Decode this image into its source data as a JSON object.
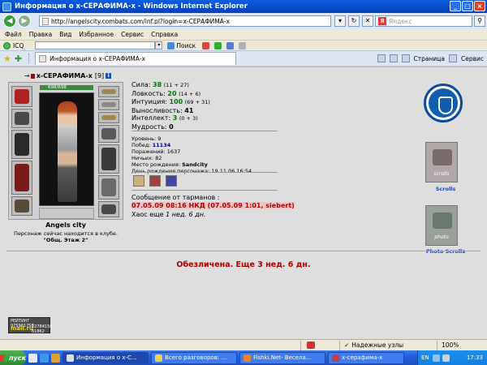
{
  "window": {
    "title": "Информация о х-СЕРАФИМА-х - Windows Internet Explorer",
    "minimize": "_",
    "maximize": "□",
    "close": "×"
  },
  "address": {
    "url": "http://angelscity.combats.com/inf.pl?login=х-СЕРАФИМА-х",
    "search_placeholder": "Яндекс"
  },
  "menu": [
    "Файл",
    "Правка",
    "Вид",
    "Избранное",
    "Сервис",
    "Справка"
  ],
  "icq_bar": {
    "label": "ICQ",
    "search_label": "Поиск"
  },
  "tabbar": {
    "tab_title": "Информация о х-СЕРАФИМА-х",
    "page_menu": "Страница",
    "tools_menu": "Сервис"
  },
  "character": {
    "name": "х-СЕРАФИМА-х",
    "level": "[9]",
    "hp": "698/698",
    "city": "Angels city",
    "club_status": "Персонаж сейчас находится в клубе.",
    "room": "\"Общ. Этаж 2\""
  },
  "stats": [
    {
      "label": "Сила:",
      "value": "38",
      "bonus": "(11 + 27)"
    },
    {
      "label": "Ловкость:",
      "value": "20",
      "bonus": "(14 + 6)"
    },
    {
      "label": "Интуиция:",
      "value": "100",
      "bonus": "(69 + 31)"
    },
    {
      "label": "Выносливость:",
      "value": "41",
      "bonus": ""
    },
    {
      "label": "Интеллект:",
      "value": "3",
      "bonus": "(0 + 3)"
    },
    {
      "label": "Мудрость:",
      "value": "0",
      "bonus": ""
    }
  ],
  "info": {
    "level_label": "Уровень:",
    "level": "9",
    "wins_label": "Побед:",
    "wins": "11134",
    "losses_label": "Поражений:",
    "losses": "1637",
    "draws_label": "Ничьих:",
    "draws": "82",
    "birthplace_label": "Место рождения:",
    "birthplace": "Sandcity",
    "birthday_label": "День рождения персонажа:",
    "birthday": "19.11.06 16:54"
  },
  "message": {
    "title": "Сообщение от тарманов :",
    "line": "07.05.09 08:16 НКД (07.05.09 1:01, siebert)",
    "chaos_prefix": "Хаос еще",
    "chaos_time": "1 нед. 6 дн."
  },
  "depersonalized": "Обезличена. Еще 3 нед. 6 дн.",
  "right_links": {
    "scrolls": "Scrolls",
    "scrolls_banner": "scrolls",
    "photo_scrolls": "Photo Scrolls",
    "photo_banner": "photo"
  },
  "counter": {
    "line1": "РЕЙТИНГ 975961758",
    "line2": "mail.ru",
    "line3a": "22784158",
    "line3b": "61862"
  },
  "statusbar": {
    "zone": "Надежные узлы",
    "zoom": "100%"
  },
  "taskbar": {
    "start": "пуск",
    "tasks": [
      "Информация о х-С...",
      "Всего разговоров: ...",
      "Fishki.Net- Весела...",
      "х-серафима-х"
    ],
    "lang": "EN",
    "clock": "17:33"
  },
  "colors": {
    "stat_value": "#007a00",
    "alert_red": "#b00000",
    "link_blue": "#1f40b0",
    "titlebar_blue": "#0a4fd0"
  }
}
